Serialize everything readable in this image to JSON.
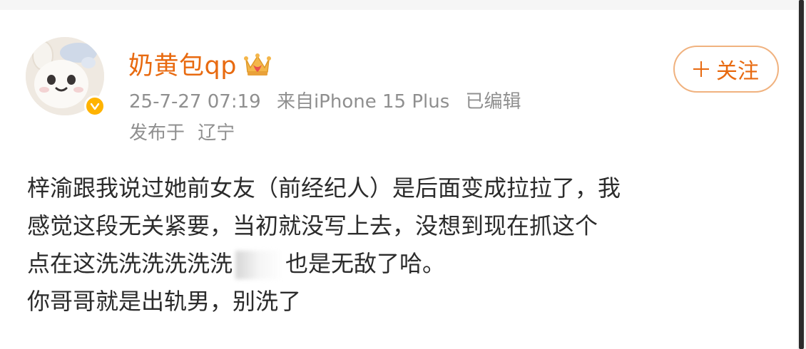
{
  "post": {
    "username": "奶黄包qp",
    "meta": {
      "date": "25-7-27 07:19",
      "source": "来自iPhone 15 Plus",
      "edited": "已编辑"
    },
    "location": {
      "label": "发布于",
      "place": "辽宁"
    },
    "follow_label": "关注",
    "content": {
      "line1": "梓渝跟我说过她前女友（前经纪人）是后面变成拉拉了，我",
      "line2": "感觉这段无关紧要，当初就没写上去，没想到现在抓这个",
      "line3_before": "点在这洗洗洗洗洗洗",
      "line3_after": "也是无敌了哈。",
      "line4": "你哥哥就是出轨男，别洗了"
    }
  },
  "icons": {
    "avatar": "cartoon-bunny-avatar",
    "badge": "verified-badge-icon",
    "crown": "crown-icon",
    "plus": "plus-icon"
  },
  "colors": {
    "username": "#e86a10",
    "meta": "#8f8f8f",
    "badge": "#ffb300",
    "follow_border": "#f0b27f"
  }
}
